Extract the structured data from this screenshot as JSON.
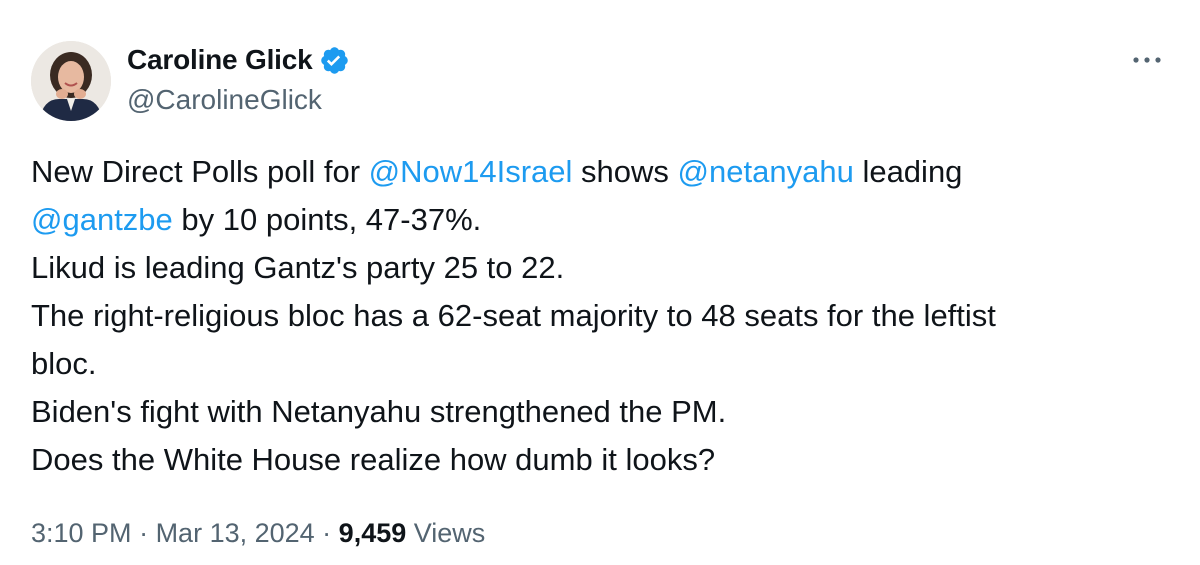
{
  "author": {
    "display_name": "Caroline Glick",
    "handle": "@CarolineGlick",
    "verified": true
  },
  "tweet": {
    "line1": {
      "a": "New Direct Polls poll for ",
      "mention1": "@Now14Israel",
      "b": " shows ",
      "mention2": "@netanyahu",
      "c": " leading"
    },
    "line2": {
      "mention3": "@gantzbe",
      "a": " by 10 points, 47-37%."
    },
    "line3": "Likud is leading Gantz's party 25 to 22.",
    "line4": "The right-religious bloc has a 62-seat majority to 48 seats for the leftist",
    "line5": "bloc.",
    "line6": "Biden's fight with Netanyahu strengthened the PM.",
    "line7": "Does the White House realize how dumb it looks?"
  },
  "meta": {
    "time": "3:10 PM",
    "sep1": " · ",
    "date": "Mar 13, 2024",
    "sep2": " · ",
    "views_count": "9,459",
    "views_label": " Views"
  },
  "colors": {
    "link": "#1d9bf0",
    "verified": "#1d9bf0",
    "secondary_text": "#536471",
    "primary_text": "#0f1419"
  },
  "icons": {
    "verified": "verified-badge-icon",
    "more": "more-options-icon"
  }
}
